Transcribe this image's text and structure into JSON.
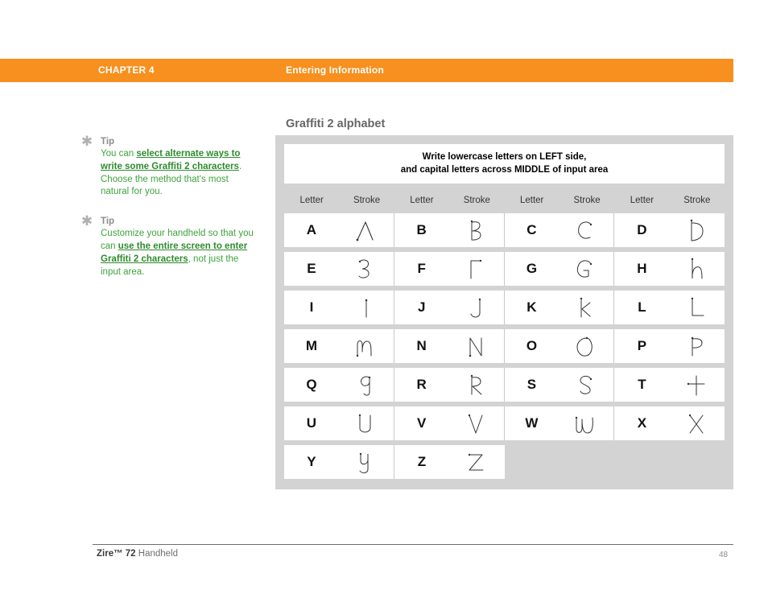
{
  "header": {
    "chapter_label": "CHAPTER 4",
    "chapter_topic": "Entering Information",
    "bar_color": "#F7901E"
  },
  "sidebar": {
    "tips": [
      {
        "icon": "asterisk-icon",
        "heading": "Tip",
        "segments": [
          {
            "text": "You can ",
            "link": false
          },
          {
            "text": "select alternate ways to write some Graffiti 2 characters",
            "link": true
          },
          {
            "text": ". Choose the method that's most natural for you.",
            "link": false
          }
        ]
      },
      {
        "icon": "asterisk-icon",
        "heading": "Tip",
        "segments": [
          {
            "text": "Customize your handheld so that you can ",
            "link": false
          },
          {
            "text": "use the entire screen to enter Graffiti 2 characters",
            "link": true
          },
          {
            "text": ", not just the input area.",
            "link": false
          }
        ]
      }
    ],
    "link_color": "#2E8B2E",
    "text_color": "#3DA33D"
  },
  "main": {
    "title": "Graffiti 2 alphabet",
    "instruction_lines": [
      "Write lowercase letters on LEFT side,",
      "and capital letters across MIDDLE of input area"
    ],
    "column_headers": [
      "Letter",
      "Stroke",
      "Letter",
      "Stroke",
      "Letter",
      "Stroke",
      "Letter",
      "Stroke"
    ],
    "panel_bg": "#D3D3D3",
    "rows": [
      [
        "A",
        "B",
        "C",
        "D"
      ],
      [
        "E",
        "F",
        "G",
        "H"
      ],
      [
        "I",
        "J",
        "K",
        "L"
      ],
      [
        "M",
        "N",
        "O",
        "P"
      ],
      [
        "Q",
        "R",
        "S",
        "T"
      ],
      [
        "U",
        "V",
        "W",
        "X"
      ],
      [
        "Y",
        "Z"
      ]
    ]
  },
  "footer": {
    "product_name": "Zire™ 72",
    "product_suffix": " Handheld",
    "page_number": "48"
  }
}
